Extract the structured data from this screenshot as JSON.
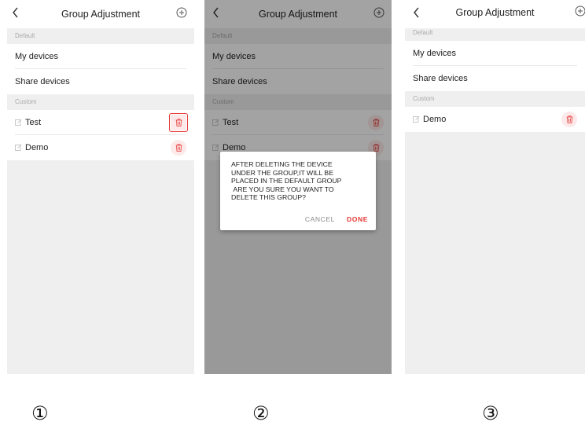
{
  "screens": [
    {
      "title": "Group Adjustment",
      "default_label": "Default",
      "default_items": [
        "My devices",
        "Share devices"
      ],
      "custom_label": "Custom",
      "custom_items": [
        "Test",
        "Demo"
      ],
      "step": "①"
    },
    {
      "title": "Group Adjustment",
      "default_label": "Default",
      "default_items": [
        "My devices",
        "Share devices"
      ],
      "custom_label": "Custom",
      "custom_items": [
        "Test",
        "Demo"
      ],
      "dialog": {
        "message": "AFTER DELETING THE DEVICE\nUNDER THE GROUP,IT WILL BE\nPLACED IN THE DEFAULT GROUP\n ARE YOU SURE YOU WANT TO\nDELETE THIS GROUP?",
        "cancel": "CANCEL",
        "done": "DONE"
      },
      "step": "②"
    },
    {
      "title": "Group Adjustment",
      "default_label": "Default",
      "default_items": [
        "My devices",
        "Share devices"
      ],
      "custom_label": "Custom",
      "custom_items": [
        "Demo"
      ],
      "step": "③"
    }
  ],
  "icons": {
    "back": "chevron-left-icon",
    "add": "plus-circle-icon",
    "edit": "edit-icon",
    "delete": "trash-icon"
  },
  "colors": {
    "accent": "#e53935",
    "delete_bg": "#fde9e9",
    "background": "#efefef"
  }
}
